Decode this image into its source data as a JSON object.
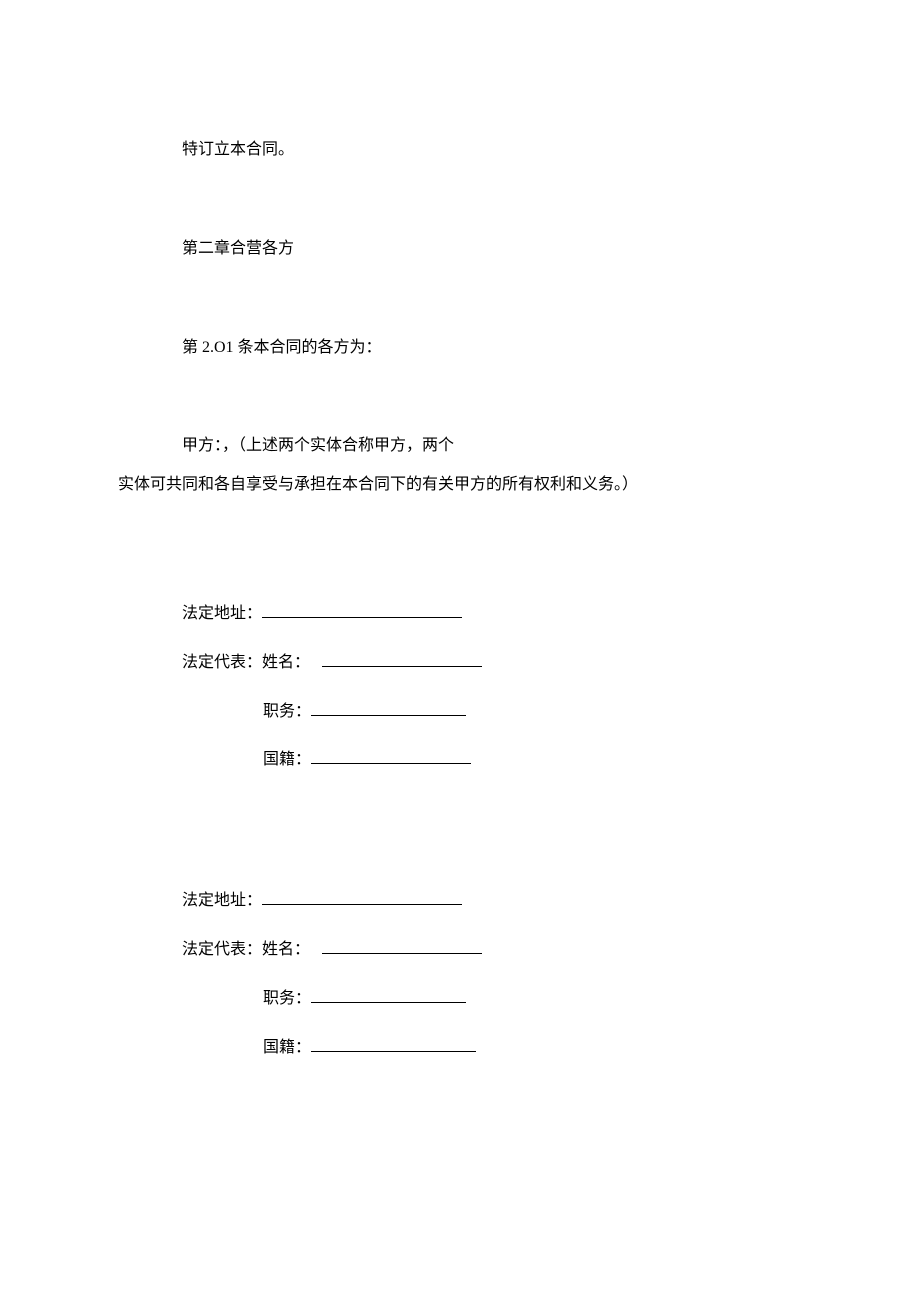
{
  "p1": "特订立本合同。",
  "p2": "第二章合营各方",
  "p3": "第 2.O1 条本合同的各方为：",
  "p4": "甲方：，（上述两个实体合称甲方，两个",
  "p5": "实体可共同和各自享受与承担在本合同下的有关甲方的所有权利和义务。）",
  "labels": {
    "address": "法定地址：",
    "rep": "法定代表：",
    "name": "姓名：   ",
    "position": "职务：",
    "nationality": "国籍："
  }
}
